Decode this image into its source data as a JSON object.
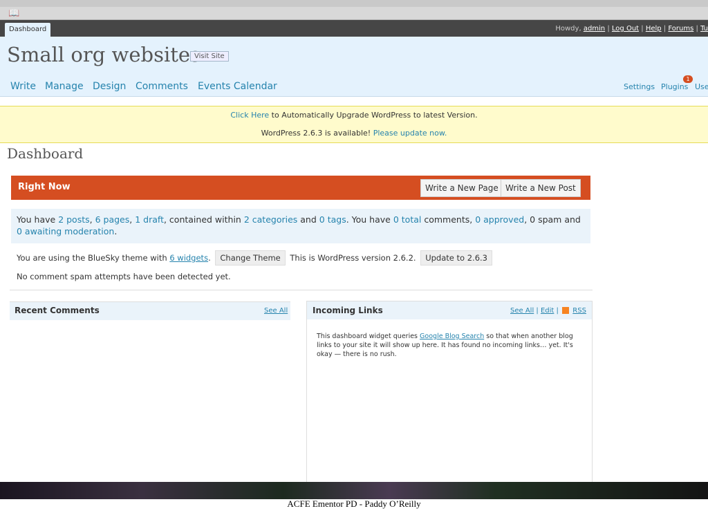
{
  "browser": {
    "bookmarks_icon": "book-icon"
  },
  "admin_bar": {
    "tab_label": "Dashboard",
    "howdy": "Howdy,",
    "user": "admin",
    "sep1": "|",
    "logout": "Log Out",
    "sep2": "|",
    "help": "Help",
    "sep3": "|",
    "forums": "Forums",
    "sep4": "|",
    "more": "Tu"
  },
  "header": {
    "site_title": "Small org websites",
    "visit_site": "Visit Site",
    "nav": [
      "Write",
      "Manage",
      "Design",
      "Comments",
      "Events Calendar"
    ],
    "subnav": [
      "Settings",
      "Plugins",
      "Use"
    ],
    "plugin_count": "1"
  },
  "notices": {
    "upgrade_link": "Click Here",
    "upgrade_text": "to Automatically Upgrade WordPress to latest Version.",
    "version_text": "WordPress 2.6.3 is available!",
    "version_link": "Please update now."
  },
  "page_title": "Dashboard",
  "right_now": {
    "title": "Right Now",
    "write_page": "Write a New Page",
    "write_post": "Write a New Post",
    "t1": "You have",
    "posts": "2 posts",
    "t2": ",",
    "pages": "6 pages",
    "t3": ",",
    "draft": "1 draft",
    "t4": ", contained within",
    "categories": "2 categories",
    "t5": "and",
    "tags": "0 tags",
    "t6": ". You have",
    "total": "0 total",
    "t7": "comments,",
    "approved": "0 approved",
    "t8": ", 0 spam and",
    "awaiting": "0 awaiting moderation",
    "t9": ".",
    "theme_pre": "You are using the BlueSky theme with",
    "widgets": "6 widgets",
    "theme_dot": ".",
    "change_theme": "Change Theme",
    "version_text": "This is WordPress version 2.6.2.",
    "update_btn": "Update to 2.6.3",
    "spam_line": "No comment spam attempts have been detected yet."
  },
  "recent_comments": {
    "title": "Recent Comments",
    "see_all": "See All"
  },
  "incoming_links": {
    "title": "Incoming Links",
    "see_all": "See All",
    "sep1": "|",
    "edit": "Edit",
    "sep2": "|",
    "rss": "RSS",
    "rss_icon": "rss-icon",
    "text1": "This dashboard widget queries",
    "link": "Google Blog Search",
    "text2": "so that when another blog links to your site it will show up here. It has found no incoming links… yet. It's okay — there is no rush."
  },
  "caption": "ACFE Ementor PD - Paddy O’Reilly"
}
